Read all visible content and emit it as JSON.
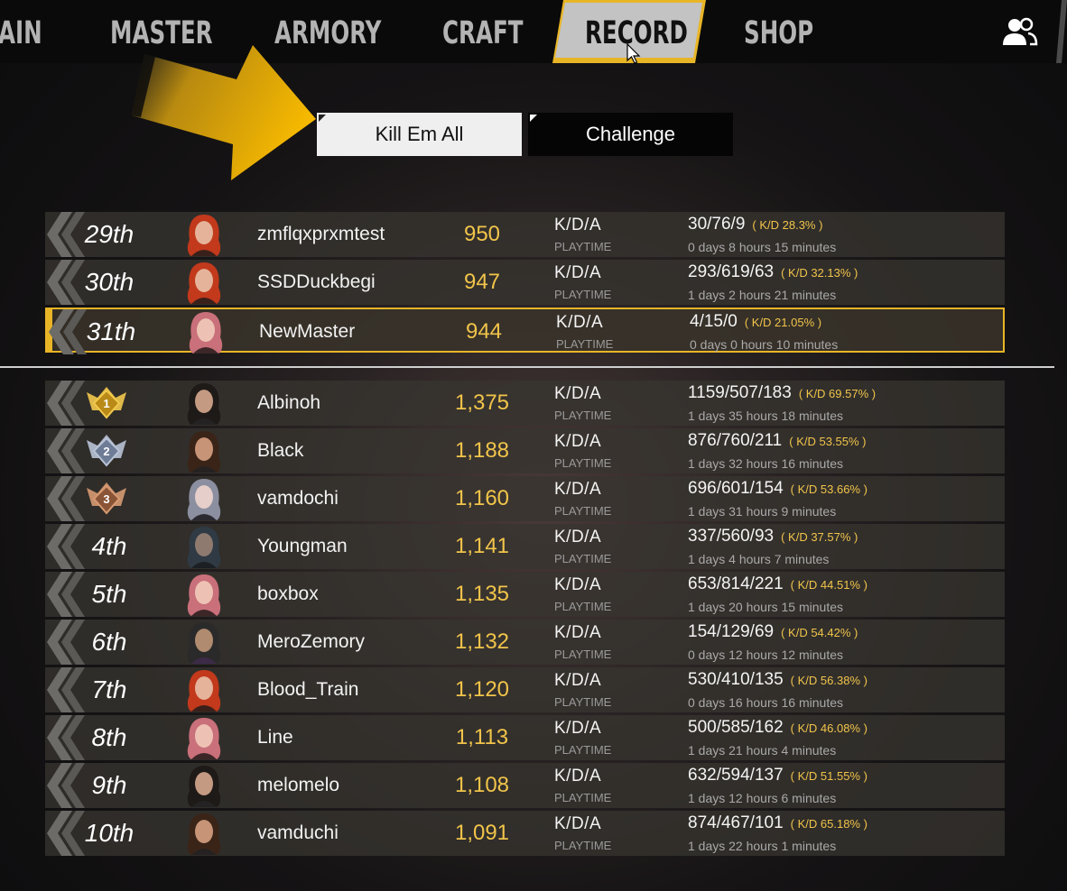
{
  "nav": {
    "tabs": [
      {
        "label": "AIN"
      },
      {
        "label": "MASTER"
      },
      {
        "label": "ARMORY"
      },
      {
        "label": "CRAFT"
      },
      {
        "label": "RECORD",
        "active": true
      },
      {
        "label": "SHOP"
      }
    ],
    "friends_icon": "friends-icon"
  },
  "modes": {
    "kill_em_all": "Kill Em All",
    "challenge": "Challenge",
    "selected": "Kill Em All"
  },
  "colors": {
    "accent_gold": "#e8b526",
    "score_gold": "#f1c44a",
    "arrow_yellow": "#f5b800"
  },
  "labels": {
    "kda": "K/D/A",
    "playtime": "PLAYTIME"
  },
  "my_ranking": [
    {
      "rank": "29th",
      "name": "zmflqxprxmtest",
      "score": "950",
      "kda": "30/76/9",
      "kd_pct": "( K/D 28.3% )",
      "playtime": "0 days 8 hours 15 minutes",
      "avatar": "red-hair-female-avatar"
    },
    {
      "rank": "30th",
      "name": "SSDDuckbegi",
      "score": "947",
      "kda": "293/619/63",
      "kd_pct": "( K/D 32.13% )",
      "playtime": "1 days 2 hours 21 minutes",
      "avatar": "red-hair-female-avatar"
    },
    {
      "rank": "31th",
      "name": "NewMaster",
      "score": "944",
      "kda": "4/15/0",
      "kd_pct": "( K/D 21.05% )",
      "playtime": "0 days 0 hours 10 minutes",
      "avatar": "pink-hair-female-avatar",
      "highlight": true
    }
  ],
  "top_ranking": [
    {
      "rank": "",
      "medal": "gold-medal-1-icon",
      "name": "Albinoh",
      "score": "1,375",
      "kda": "1159/507/183",
      "kd_pct": "( K/D 69.57% )",
      "playtime": "1 days 35 hours 18 minutes",
      "avatar": "dark-hair-male-avatar"
    },
    {
      "rank": "",
      "medal": "silver-medal-2-icon",
      "name": "Black",
      "score": "1,188",
      "kda": "876/760/211",
      "kd_pct": "( K/D 53.55% )",
      "playtime": "1 days 32 hours 16 minutes",
      "avatar": "bearded-male-avatar"
    },
    {
      "rank": "",
      "medal": "bronze-medal-3-icon",
      "name": "vamdochi",
      "score": "1,160",
      "kda": "696/601/154",
      "kd_pct": "( K/D 53.66% )",
      "playtime": "1 days 31 hours 9 minutes",
      "avatar": "grey-hair-female-avatar"
    },
    {
      "rank": "4th",
      "name": "Youngman",
      "score": "1,141",
      "kda": "337/560/93",
      "kd_pct": "( K/D 37.57% )",
      "playtime": "1 days 4 hours 7 minutes",
      "avatar": "hooded-avatar"
    },
    {
      "rank": "5th",
      "name": "boxbox",
      "score": "1,135",
      "kda": "653/814/221",
      "kd_pct": "( K/D 44.51% )",
      "playtime": "1 days 20 hours 15 minutes",
      "avatar": "pink-hair-female-avatar"
    },
    {
      "rank": "6th",
      "name": "MeroZemory",
      "score": "1,132",
      "kda": "154/129/69",
      "kd_pct": "( K/D 54.42% )",
      "playtime": "0 days 12 hours 12 minutes",
      "avatar": "masked-avatar"
    },
    {
      "rank": "7th",
      "name": "Blood_Train",
      "score": "1,120",
      "kda": "530/410/135",
      "kd_pct": "( K/D 56.38% )",
      "playtime": "0 days 16 hours 16 minutes",
      "avatar": "red-hair-female-avatar"
    },
    {
      "rank": "8th",
      "name": "Line",
      "score": "1,113",
      "kda": "500/585/162",
      "kd_pct": "( K/D 46.08% )",
      "playtime": "1 days 21 hours 4 minutes",
      "avatar": "pink-hair-female-avatar"
    },
    {
      "rank": "9th",
      "name": "melomelo",
      "score": "1,108",
      "kda": "632/594/137",
      "kd_pct": "( K/D 51.55% )",
      "playtime": "1 days 12 hours 6 minutes",
      "avatar": "dark-hair-male-avatar"
    },
    {
      "rank": "10th",
      "name": "vamduchi",
      "score": "1,091",
      "kda": "874/467/101",
      "kd_pct": "( K/D 65.18% )",
      "playtime": "1 days 22 hours 1 minutes",
      "avatar": "bearded-male-avatar"
    }
  ]
}
